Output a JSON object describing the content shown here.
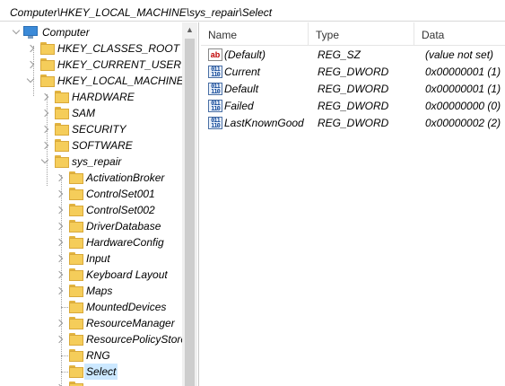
{
  "address_bar": "Computer\\HKEY_LOCAL_MACHINE\\sys_repair\\Select",
  "tree": {
    "computer": "Computer",
    "hives": [
      {
        "label": "HKEY_CLASSES_ROOT"
      },
      {
        "label": "HKEY_CURRENT_USER"
      },
      {
        "label": "HKEY_LOCAL_MACHINE"
      }
    ],
    "hklm_children": [
      {
        "label": "HARDWARE"
      },
      {
        "label": "SAM"
      },
      {
        "label": "SECURITY"
      },
      {
        "label": "SOFTWARE"
      },
      {
        "label": "sys_repair"
      }
    ],
    "sys_repair_children": [
      {
        "label": "ActivationBroker"
      },
      {
        "label": "ControlSet001"
      },
      {
        "label": "ControlSet002"
      },
      {
        "label": "DriverDatabase"
      },
      {
        "label": "HardwareConfig"
      },
      {
        "label": "Input"
      },
      {
        "label": "Keyboard Layout"
      },
      {
        "label": "Maps"
      },
      {
        "label": "MountedDevices"
      },
      {
        "label": "ResourceManager"
      },
      {
        "label": "ResourcePolicyStore"
      },
      {
        "label": "RNG"
      },
      {
        "label": "Select"
      }
    ]
  },
  "list": {
    "columns": {
      "name": "Name",
      "type": "Type",
      "data": "Data"
    },
    "values": [
      {
        "icon": "string-value-icon",
        "name": "(Default)",
        "type": "REG_SZ",
        "data": "(value not set)"
      },
      {
        "icon": "dword-value-icon",
        "name": "Current",
        "type": "REG_DWORD",
        "data": "0x00000001 (1)"
      },
      {
        "icon": "dword-value-icon",
        "name": "Default",
        "type": "REG_DWORD",
        "data": "0x00000001 (1)"
      },
      {
        "icon": "dword-value-icon",
        "name": "Failed",
        "type": "REG_DWORD",
        "data": "0x00000000 (0)"
      },
      {
        "icon": "dword-value-icon",
        "name": "LastKnownGood",
        "type": "REG_DWORD",
        "data": "0x00000002 (2)"
      }
    ]
  },
  "icons": {
    "string": "ab",
    "dword": "011\n110"
  },
  "colors": {
    "selection": "#cce8ff",
    "folder": "#f5cd5a"
  }
}
